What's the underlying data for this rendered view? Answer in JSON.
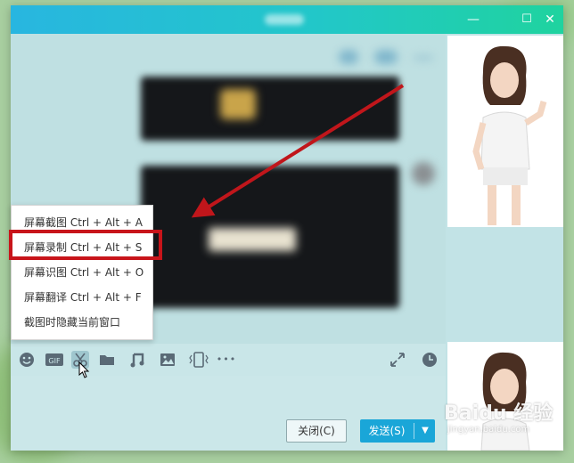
{
  "window": {
    "minimize_glyph": "—",
    "maximize_glyph": "☐",
    "close_glyph": "✕"
  },
  "context_menu": {
    "items": [
      {
        "label": "屏幕截图 Ctrl + Alt + A"
      },
      {
        "label": "屏幕录制 Ctrl + Alt + S"
      },
      {
        "label": "屏幕识图 Ctrl + Alt + O"
      },
      {
        "label": "屏幕翻译 Ctrl + Alt + F"
      },
      {
        "label": "截图时隐藏当前窗口"
      }
    ],
    "highlighted_item": "屏幕录制 Ctrl + Alt + S"
  },
  "toolbar": {
    "icons": [
      "emoji-icon",
      "gif-icon",
      "scissors-icon",
      "folder-icon",
      "music-icon",
      "image-icon",
      "phone-vibrate-icon",
      "more-icon",
      "expand-icon",
      "clock-icon"
    ],
    "gif_label": "GIF",
    "more_glyph": "•••"
  },
  "buttons": {
    "close_label": "关闭(C)",
    "send_label": "发送(S)",
    "send_dropdown_glyph": "▼"
  },
  "watermark": {
    "brand": "Baidu 经验",
    "url": "jingyan.baidu.com"
  },
  "colors": {
    "titlebar_start": "#28b6e0",
    "titlebar_end": "#1fd39f",
    "highlight_red": "#c8141a",
    "send_blue": "#1aa6d8"
  }
}
